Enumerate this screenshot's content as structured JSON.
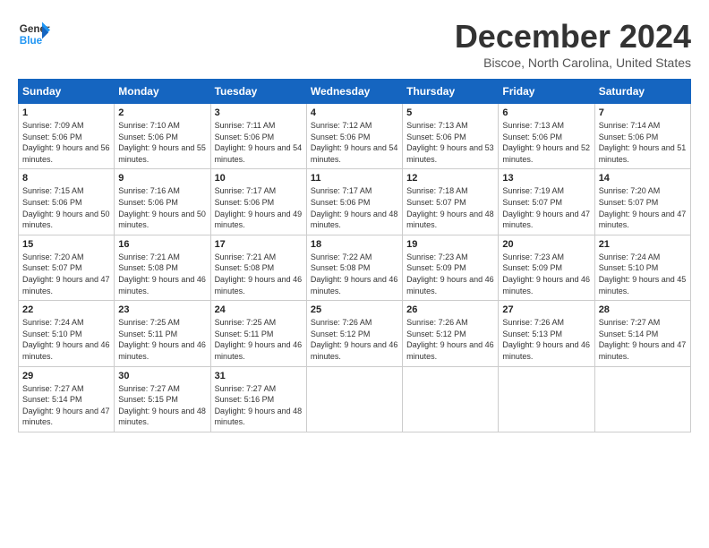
{
  "header": {
    "logo_line1": "General",
    "logo_line2": "Blue",
    "month_title": "December 2024",
    "location": "Biscoe, North Carolina, United States"
  },
  "weekdays": [
    "Sunday",
    "Monday",
    "Tuesday",
    "Wednesday",
    "Thursday",
    "Friday",
    "Saturday"
  ],
  "weeks": [
    [
      {
        "day": "1",
        "sunrise": "7:09 AM",
        "sunset": "5:06 PM",
        "daylight": "9 hours and 56 minutes."
      },
      {
        "day": "2",
        "sunrise": "7:10 AM",
        "sunset": "5:06 PM",
        "daylight": "9 hours and 55 minutes."
      },
      {
        "day": "3",
        "sunrise": "7:11 AM",
        "sunset": "5:06 PM",
        "daylight": "9 hours and 54 minutes."
      },
      {
        "day": "4",
        "sunrise": "7:12 AM",
        "sunset": "5:06 PM",
        "daylight": "9 hours and 54 minutes."
      },
      {
        "day": "5",
        "sunrise": "7:13 AM",
        "sunset": "5:06 PM",
        "daylight": "9 hours and 53 minutes."
      },
      {
        "day": "6",
        "sunrise": "7:13 AM",
        "sunset": "5:06 PM",
        "daylight": "9 hours and 52 minutes."
      },
      {
        "day": "7",
        "sunrise": "7:14 AM",
        "sunset": "5:06 PM",
        "daylight": "9 hours and 51 minutes."
      }
    ],
    [
      {
        "day": "8",
        "sunrise": "7:15 AM",
        "sunset": "5:06 PM",
        "daylight": "9 hours and 50 minutes."
      },
      {
        "day": "9",
        "sunrise": "7:16 AM",
        "sunset": "5:06 PM",
        "daylight": "9 hours and 50 minutes."
      },
      {
        "day": "10",
        "sunrise": "7:17 AM",
        "sunset": "5:06 PM",
        "daylight": "9 hours and 49 minutes."
      },
      {
        "day": "11",
        "sunrise": "7:17 AM",
        "sunset": "5:06 PM",
        "daylight": "9 hours and 48 minutes."
      },
      {
        "day": "12",
        "sunrise": "7:18 AM",
        "sunset": "5:07 PM",
        "daylight": "9 hours and 48 minutes."
      },
      {
        "day": "13",
        "sunrise": "7:19 AM",
        "sunset": "5:07 PM",
        "daylight": "9 hours and 47 minutes."
      },
      {
        "day": "14",
        "sunrise": "7:20 AM",
        "sunset": "5:07 PM",
        "daylight": "9 hours and 47 minutes."
      }
    ],
    [
      {
        "day": "15",
        "sunrise": "7:20 AM",
        "sunset": "5:07 PM",
        "daylight": "9 hours and 47 minutes."
      },
      {
        "day": "16",
        "sunrise": "7:21 AM",
        "sunset": "5:08 PM",
        "daylight": "9 hours and 46 minutes."
      },
      {
        "day": "17",
        "sunrise": "7:21 AM",
        "sunset": "5:08 PM",
        "daylight": "9 hours and 46 minutes."
      },
      {
        "day": "18",
        "sunrise": "7:22 AM",
        "sunset": "5:08 PM",
        "daylight": "9 hours and 46 minutes."
      },
      {
        "day": "19",
        "sunrise": "7:23 AM",
        "sunset": "5:09 PM",
        "daylight": "9 hours and 46 minutes."
      },
      {
        "day": "20",
        "sunrise": "7:23 AM",
        "sunset": "5:09 PM",
        "daylight": "9 hours and 46 minutes."
      },
      {
        "day": "21",
        "sunrise": "7:24 AM",
        "sunset": "5:10 PM",
        "daylight": "9 hours and 45 minutes."
      }
    ],
    [
      {
        "day": "22",
        "sunrise": "7:24 AM",
        "sunset": "5:10 PM",
        "daylight": "9 hours and 46 minutes."
      },
      {
        "day": "23",
        "sunrise": "7:25 AM",
        "sunset": "5:11 PM",
        "daylight": "9 hours and 46 minutes."
      },
      {
        "day": "24",
        "sunrise": "7:25 AM",
        "sunset": "5:11 PM",
        "daylight": "9 hours and 46 minutes."
      },
      {
        "day": "25",
        "sunrise": "7:26 AM",
        "sunset": "5:12 PM",
        "daylight": "9 hours and 46 minutes."
      },
      {
        "day": "26",
        "sunrise": "7:26 AM",
        "sunset": "5:12 PM",
        "daylight": "9 hours and 46 minutes."
      },
      {
        "day": "27",
        "sunrise": "7:26 AM",
        "sunset": "5:13 PM",
        "daylight": "9 hours and 46 minutes."
      },
      {
        "day": "28",
        "sunrise": "7:27 AM",
        "sunset": "5:14 PM",
        "daylight": "9 hours and 47 minutes."
      }
    ],
    [
      {
        "day": "29",
        "sunrise": "7:27 AM",
        "sunset": "5:14 PM",
        "daylight": "9 hours and 47 minutes."
      },
      {
        "day": "30",
        "sunrise": "7:27 AM",
        "sunset": "5:15 PM",
        "daylight": "9 hours and 48 minutes."
      },
      {
        "day": "31",
        "sunrise": "7:27 AM",
        "sunset": "5:16 PM",
        "daylight": "9 hours and 48 minutes."
      },
      null,
      null,
      null,
      null
    ]
  ],
  "labels": {
    "sunrise_prefix": "Sunrise: ",
    "sunset_prefix": "Sunset: ",
    "daylight_prefix": "Daylight: "
  }
}
